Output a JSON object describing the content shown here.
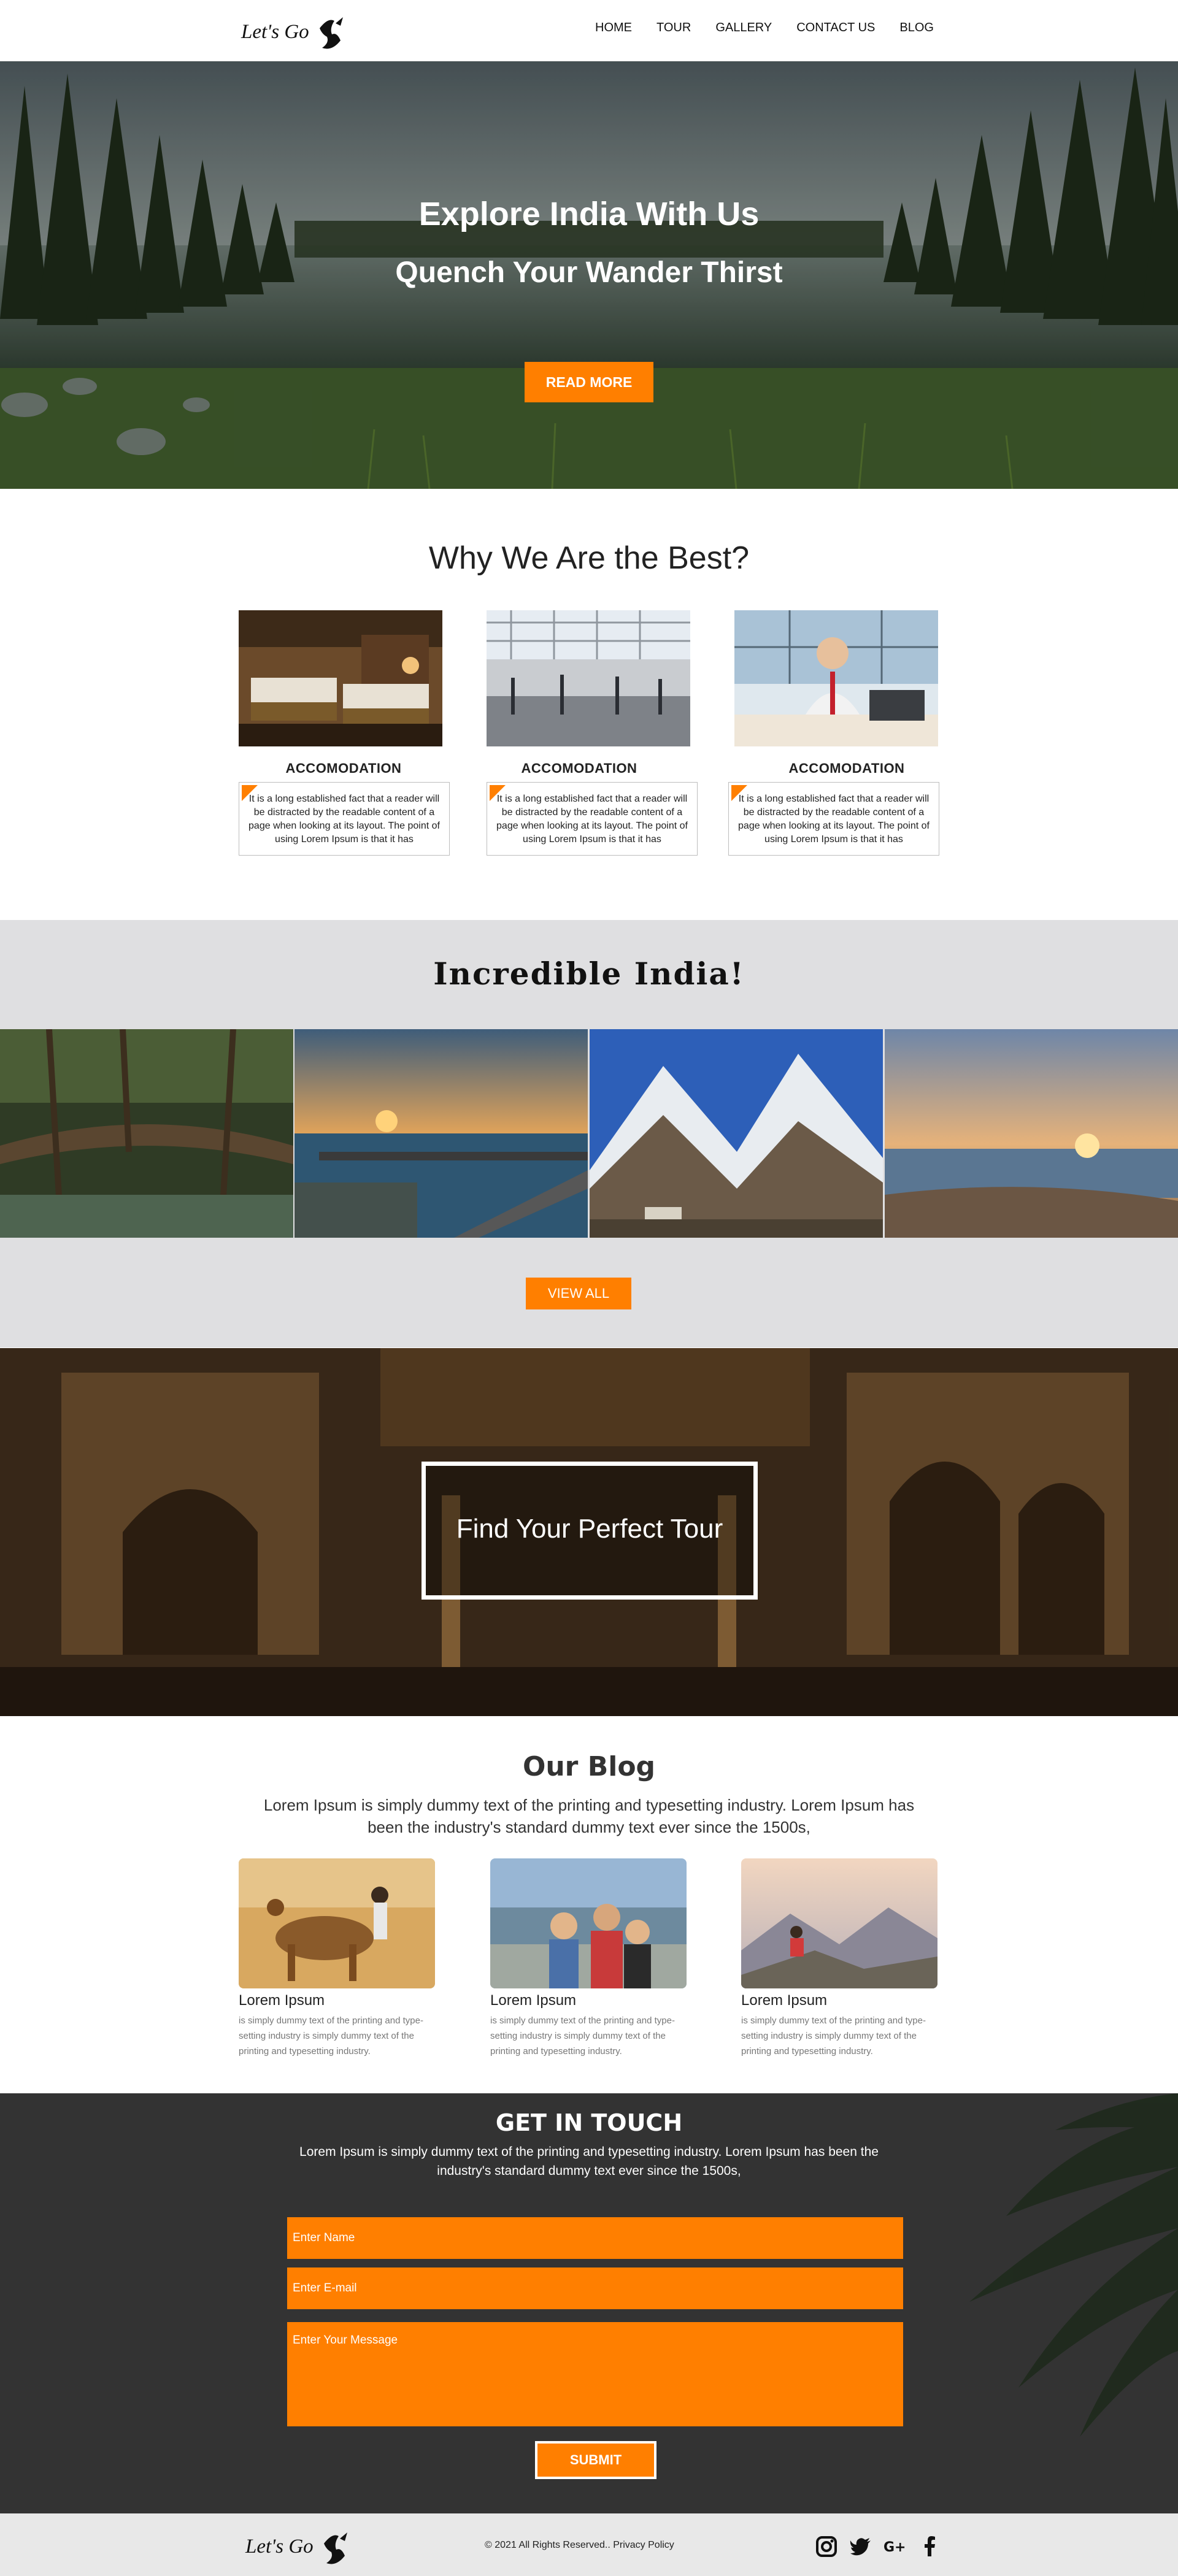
{
  "nav": {
    "logo_text": "Let's Go",
    "items": [
      {
        "label": "HOME"
      },
      {
        "label": "TOUR"
      },
      {
        "label": "GALLERY"
      },
      {
        "label": "CONTACT US"
      },
      {
        "label": "BLOG"
      }
    ]
  },
  "hero": {
    "title": "Explore India With Us",
    "subtitle": "Quench Your Wander Thirst",
    "button": "READ MORE"
  },
  "why": {
    "title": "Why We Are the Best?",
    "features": [
      {
        "label": "ACCOMODATION",
        "text": "It is a long established fact that a reader will be distracted by the readable content of a page when looking at its layout. The point of using Lorem Ipsum is that it has"
      },
      {
        "label": "ACCOMODATION",
        "text": "It is a long established fact that a reader will be distracted by the readable content of a page when looking at its layout. The point of using Lorem Ipsum is that it has"
      },
      {
        "label": "ACCOMODATION",
        "text": "It is a long established fact that a reader will be distracted by the readable content of a page when looking at its layout. The point of using Lorem Ipsum is that it has"
      }
    ]
  },
  "incredible": {
    "title": "Incredible India!",
    "button": "VIEW ALL"
  },
  "tour": {
    "text": "Find Your Perfect Tour"
  },
  "blog": {
    "title": "Our Blog",
    "intro": "Lorem Ipsum is simply dummy text of the printing and typesetting industry. Lorem Ipsum has been the industry's standard dummy text ever since the 1500s,",
    "posts": [
      {
        "title": "Lorem Ipsum",
        "text": "is simply dummy text of the printing and type-setting industry is simply dummy text of the printing and typesetting industry."
      },
      {
        "title": "Lorem Ipsum",
        "text": "is simply dummy text of the printing and type-setting industry is simply dummy text of the printing and typesetting industry."
      },
      {
        "title": "Lorem Ipsum",
        "text": "is simply dummy text of the printing and type-setting industry is simply dummy text of the printing and typesetting industry."
      }
    ]
  },
  "contact": {
    "title": "GET IN TOUCH",
    "intro": "Lorem Ipsum is simply dummy text of the printing and typesetting industry. Lorem Ipsum has been the industry's standard dummy text ever since the 1500s,",
    "name_placeholder": "Enter Name",
    "email_placeholder": "Enter E-mail",
    "message_placeholder": "Enter Your Message",
    "submit": "SUBMIT"
  },
  "footer": {
    "logo_text": "Let's Go",
    "copyright": "© 2021 All Rights Reserved.. Privacy Policy",
    "social": [
      "instagram-icon",
      "twitter-icon",
      "google-plus-icon",
      "facebook-icon"
    ]
  },
  "colors": {
    "accent": "#ff7f00",
    "dark": "#333333",
    "light_gray": "#dfdfe1"
  }
}
